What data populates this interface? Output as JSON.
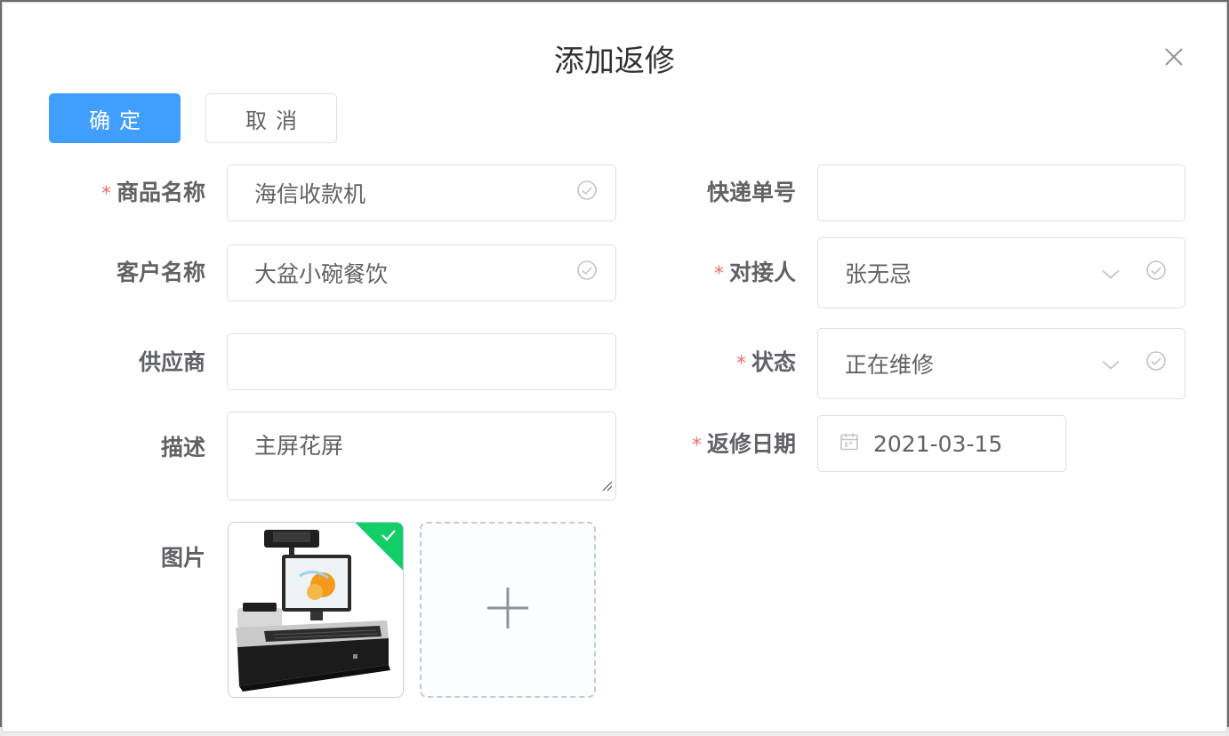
{
  "dialog": {
    "title": "添加返修",
    "confirm_label": "确定",
    "cancel_label": "取消"
  },
  "form": {
    "product_name": {
      "label": "商品名称",
      "value": "海信收款机",
      "required": true
    },
    "customer_name": {
      "label": "客户名称",
      "value": "大盆小碗餐饮",
      "required": false
    },
    "supplier": {
      "label": "供应商",
      "value": "",
      "required": false
    },
    "description": {
      "label": "描述",
      "value": "主屏花屏",
      "required": false
    },
    "image": {
      "label": "图片"
    },
    "tracking_no": {
      "label": "快递单号",
      "value": "",
      "required": false
    },
    "contact": {
      "label": "对接人",
      "value": "张无忌",
      "required": true
    },
    "status": {
      "label": "状态",
      "value": "正在维修",
      "required": true
    },
    "repair_date": {
      "label": "返修日期",
      "value": "2021-03-15",
      "required": true
    }
  },
  "icons": {
    "close": "close-icon",
    "valid": "check-circle-icon",
    "dropdown": "chevron-down-icon",
    "calendar": "calendar-icon",
    "plus": "plus-icon"
  },
  "colors": {
    "primary": "#409eff",
    "required": "#f56c6c",
    "success": "#13ce66",
    "border": "#dcdfe6"
  }
}
